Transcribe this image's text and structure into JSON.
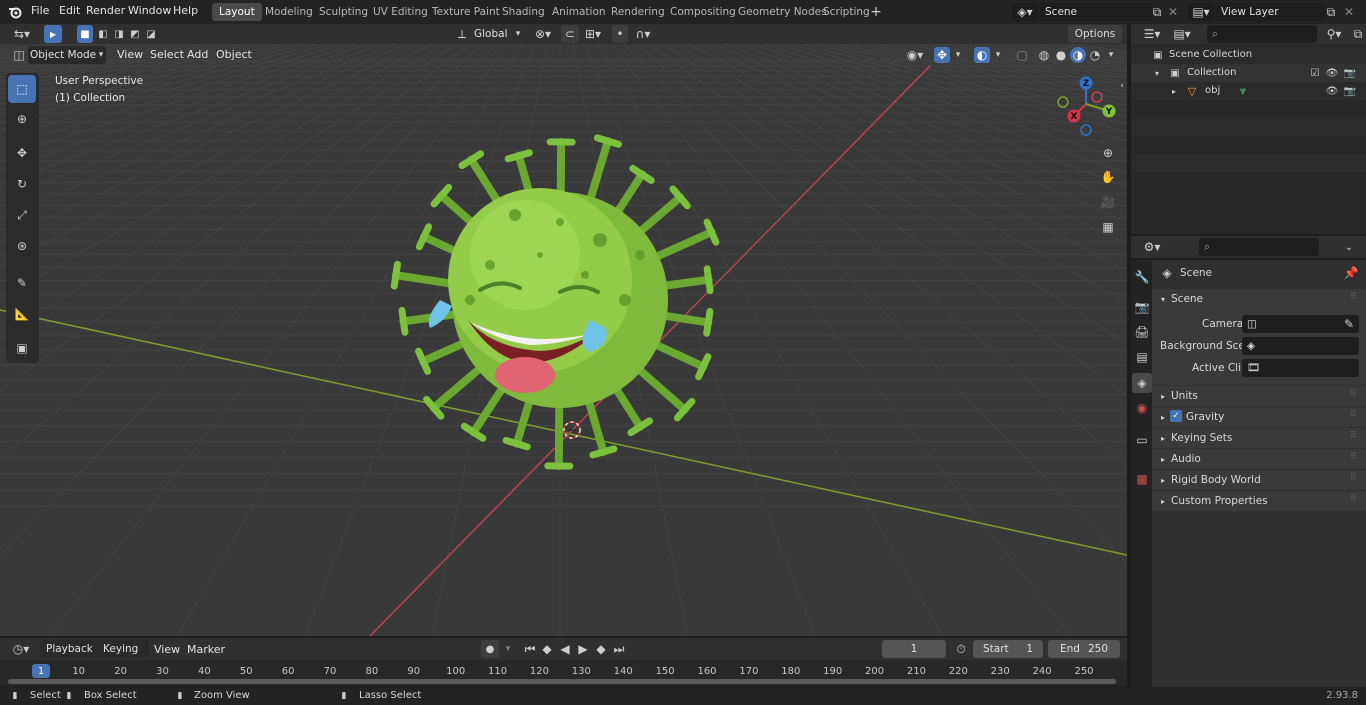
{
  "topbar": {
    "menus": [
      "File",
      "Edit",
      "Render",
      "Window",
      "Help"
    ],
    "workspaces": [
      "Layout",
      "Modeling",
      "Sculpting",
      "UV Editing",
      "Texture Paint",
      "Shading",
      "Animation",
      "Rendering",
      "Compositing",
      "Geometry Nodes",
      "Scripting"
    ],
    "active_workspace": "Layout",
    "scene_name": "Scene",
    "view_layer": "View Layer"
  },
  "viewport_header": {
    "mode": "Object Mode",
    "menus": [
      "View",
      "Select",
      "Add",
      "Object"
    ],
    "transform_orientation": "Global",
    "options_label": "Options"
  },
  "viewport": {
    "overlay_line1": "User Perspective",
    "overlay_line2": "(1) Collection",
    "gizmo_axes": [
      "Z",
      "Y",
      "X"
    ]
  },
  "outliner": {
    "scene_collection": "Scene Collection",
    "collection": "Collection",
    "object": "obj"
  },
  "properties": {
    "context_label": "Scene",
    "panel_title": "Scene",
    "camera_label": "Camera",
    "background_scene_label": "Background Scene",
    "active_clip_label": "Active Clip",
    "subpanels": [
      "Units",
      "Gravity",
      "Keying Sets",
      "Audio",
      "Rigid Body World",
      "Custom Properties"
    ]
  },
  "timeline": {
    "menus": [
      "Playback",
      "Keying",
      "View",
      "Marker"
    ],
    "current_frame": "1",
    "start_label": "Start",
    "start_value": "1",
    "end_label": "End",
    "end_value": "250",
    "ticks": [
      "1",
      "10",
      "20",
      "30",
      "40",
      "50",
      "60",
      "70",
      "80",
      "90",
      "100",
      "110",
      "120",
      "130",
      "140",
      "150",
      "160",
      "170",
      "180",
      "190",
      "200",
      "210",
      "220",
      "230",
      "240",
      "250"
    ]
  },
  "statusbar": {
    "select": "Select",
    "box_select": "Box Select",
    "zoom_view": "Zoom View",
    "lasso_select": "Lasso Select",
    "version": "2.93.8"
  },
  "colors": {
    "accent": "#4772b3",
    "virus_green": "#8bc34a",
    "x_axis": "#c8474f",
    "y_axis": "#7ea02f"
  }
}
